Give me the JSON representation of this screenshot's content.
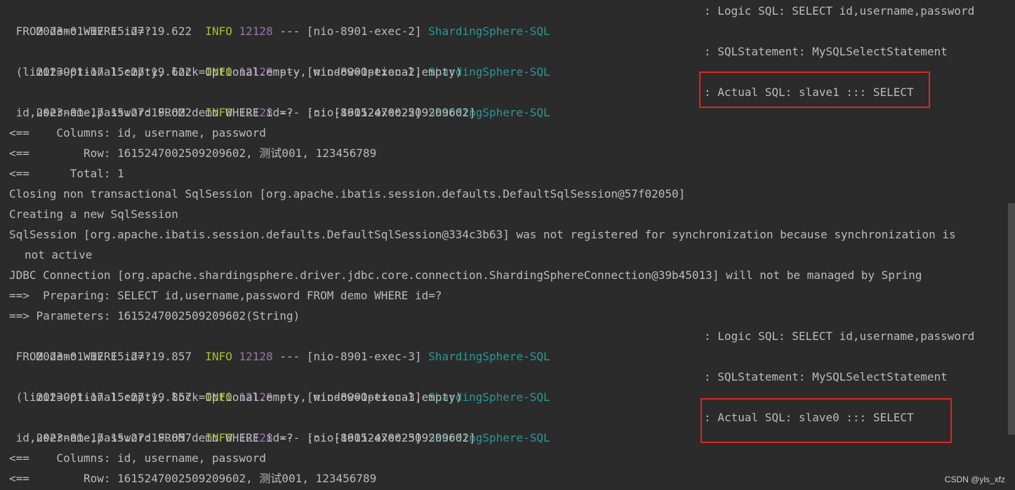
{
  "log": {
    "l1": {
      "ts": "2023-01-17 15:27:19.622",
      "level": "INFO",
      "pid": "12128",
      "sep": "---",
      "thread": "[nio-8901-exec-2]",
      "logger": "ShardingSphere-SQL",
      "msg": ": Logic SQL: SELECT id,username,password"
    },
    "l1c": " FROM demo WHERE id=?",
    "l2": {
      "ts": "2023-01-17 15:27:19.622",
      "level": "INFO",
      "pid": "12128",
      "sep": "---",
      "thread": "[nio-8901-exec-2]",
      "logger": "ShardingSphere-SQL",
      "msg": ": SQLStatement: MySQLSelectStatement"
    },
    "l2c": " (limit=Optional.empty, lock=Optional.empty, window=Optional.empty)",
    "l3": {
      "ts": "2023-01-17 15:27:19.622",
      "level": "INFO",
      "pid": "12128",
      "sep": "---",
      "thread": "[nio-8901-exec-2]",
      "logger": "ShardingSphere-SQL",
      "msg": ": Actual SQL: slave1 ::: SELECT"
    },
    "l3c": " id,username,password FROM demo WHERE id=?  ::: [1615247002509209602]",
    "l4": "<==    Columns: id, username, password",
    "l5": "<==        Row: 1615247002509209602, 测试001, 123456789",
    "l6": "<==      Total: 1",
    "l7": "Closing non transactional SqlSession [org.apache.ibatis.session.defaults.DefaultSqlSession@57f02050]",
    "l8": "Creating a new SqlSession",
    "l9": "SqlSession [org.apache.ibatis.session.defaults.DefaultSqlSession@334c3b63] was not registered for synchronization because synchronization is",
    "l9c": "not active",
    "l10": "JDBC Connection [org.apache.shardingsphere.driver.jdbc.core.connection.ShardingSphereConnection@39b45013] will not be managed by Spring",
    "l11": "==>  Preparing: SELECT id,username,password FROM demo WHERE id=?",
    "l12": "==> Parameters: 1615247002509209602(String)",
    "l13": {
      "ts": "2023-01-17 15:27:19.857",
      "level": "INFO",
      "pid": "12128",
      "sep": "---",
      "thread": "[nio-8901-exec-3]",
      "logger": "ShardingSphere-SQL",
      "msg": ": Logic SQL: SELECT id,username,password"
    },
    "l13c": " FROM demo WHERE id=?",
    "l14": {
      "ts": "2023-01-17 15:27:19.857",
      "level": "INFO",
      "pid": "12128",
      "sep": "---",
      "thread": "[nio-8901-exec-3]",
      "logger": "ShardingSphere-SQL",
      "msg": ": SQLStatement: MySQLSelectStatement"
    },
    "l14c": " (limit=Optional.empty, lock=Optional.empty, window=Optional.empty)",
    "l15": {
      "ts": "2023-01-17 15:27:19.857",
      "level": "INFO",
      "pid": "12128",
      "sep": "---",
      "thread": "[nio-8901-exec-3]",
      "logger": "ShardingSphere-SQL",
      "msg": ": Actual SQL: slave0 ::: SELECT"
    },
    "l15c": " id,username,password FROM demo WHERE id=?  ::: [1615247002509209602]",
    "l16": "<==    Columns: id, username, password",
    "l17": "<==        Row: 1615247002509209602, 测试001, 123456789"
  },
  "watermark": "CSDN @yls_xfz",
  "colors": {
    "background": "#2b2b2b",
    "text": "#bbbbbb",
    "info_level": "#a8c023",
    "pid": "#9876aa",
    "logger": "#299999",
    "highlight_box": "#e8221b"
  }
}
